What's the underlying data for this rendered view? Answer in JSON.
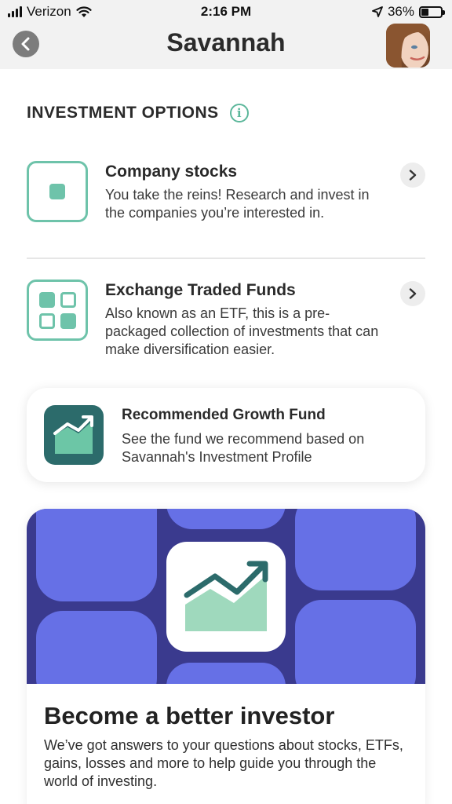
{
  "status_bar": {
    "carrier": "Verizon",
    "time": "2:16 PM",
    "battery_percent": "36%",
    "battery_level": 0.36,
    "icons": [
      "signal-bars-icon",
      "wifi-icon",
      "location-arrow-icon",
      "battery-icon"
    ]
  },
  "nav": {
    "title": "Savannah",
    "back_icon": "chevron-left-icon",
    "avatar": "user-avatar-photo"
  },
  "section": {
    "title": "INVESTMENT OPTIONS",
    "info_icon": "info-icon",
    "info_glyph": "i"
  },
  "options": [
    {
      "title": "Company stocks",
      "description": "You take the reins! Research and invest in the companies you’re interested in.",
      "icon": "single-square-icon"
    },
    {
      "title": "Exchange Traded Funds",
      "description": "Also known as an ETF, this is a pre-packaged collection of investments that can make diversification easier.",
      "icon": "four-squares-grid-icon"
    }
  ],
  "recommend_card": {
    "title": "Recommended Growth Fund",
    "description": "See the fund we recommend based on Savannah's Investment Profile",
    "icon": "growth-chart-icon"
  },
  "banner_card": {
    "title": "Become a better investor",
    "description": "We’ve got answers to your questions about stocks, ETFs, gains, losses and more to help guide you through the world of investing.",
    "icon": "trending-up-chart-icon"
  },
  "colors": {
    "accent_green": "#6ec3aa",
    "dark_teal": "#2c6b6b",
    "banner_navy": "#3a3a8e",
    "banner_blob": "#6670e6",
    "chart_green": "#9fd9bd"
  }
}
